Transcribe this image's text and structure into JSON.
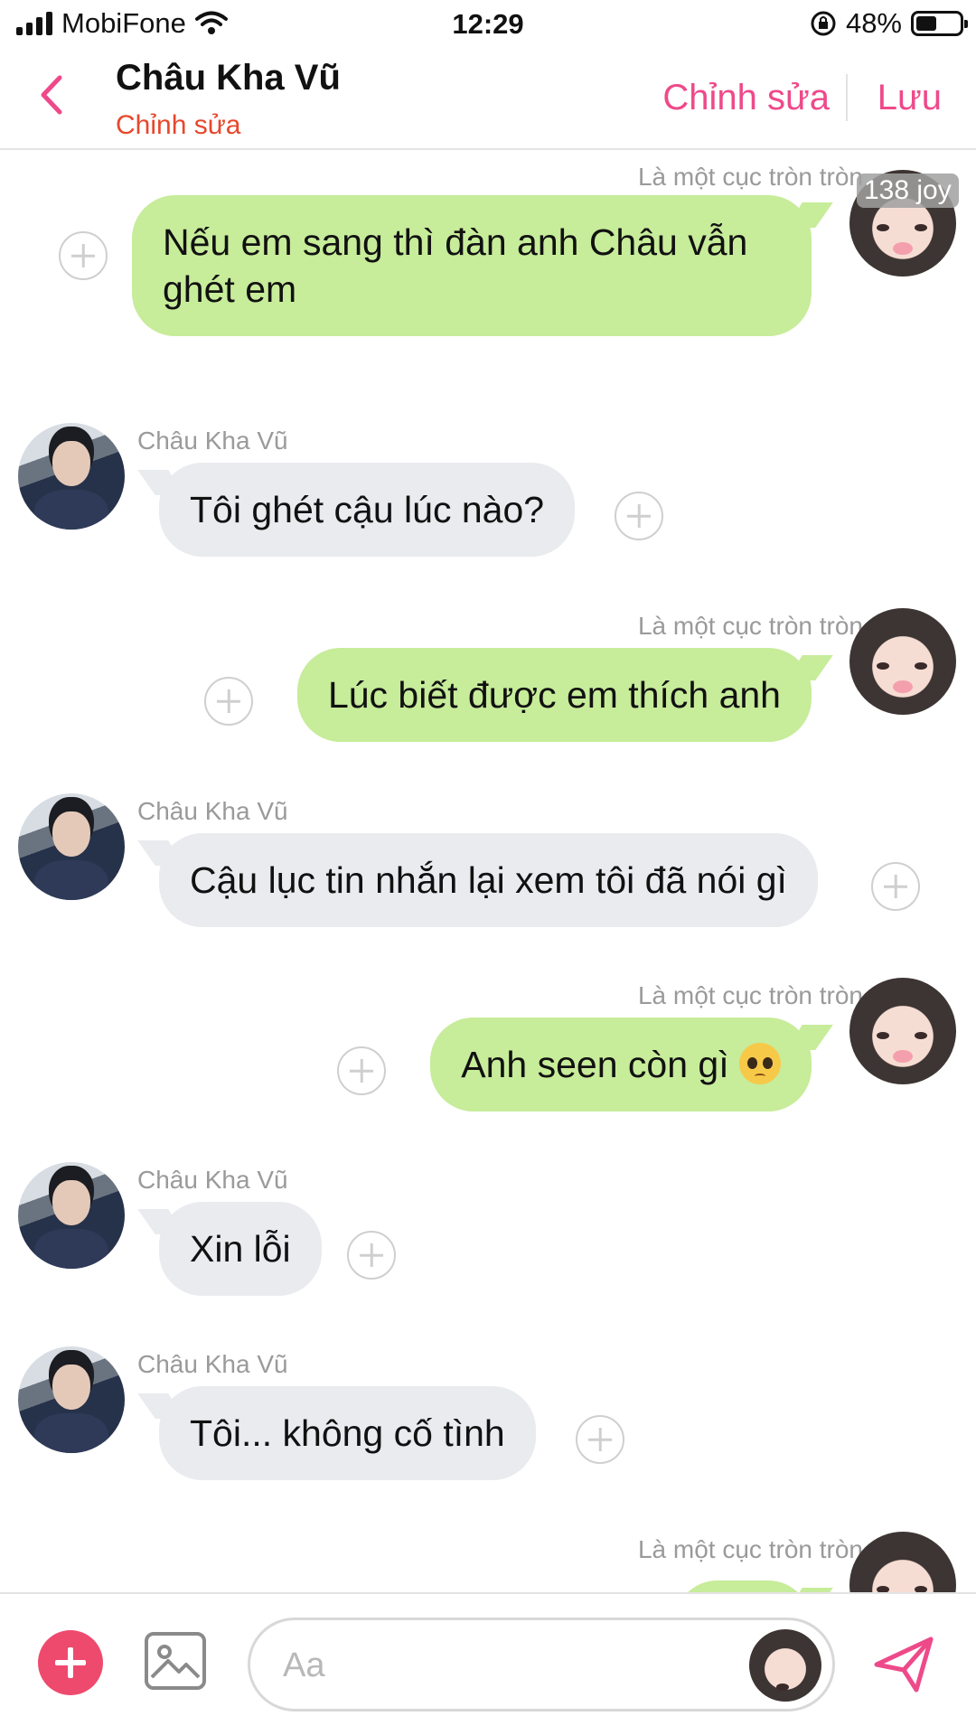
{
  "status_bar": {
    "carrier": "MobiFone",
    "time": "12:29",
    "battery_percent": "48%",
    "battery_level": 0.48,
    "icons": [
      "signal-icon",
      "wifi-icon",
      "rotation-lock-icon",
      "battery-icon"
    ]
  },
  "header": {
    "back_icon": "chevron-left-icon",
    "title": "Châu Kha Vũ",
    "subtitle": "Chỉnh sửa",
    "edit_label": "Chỉnh sửa",
    "save_label": "Lưu",
    "accent_color": "#ee4a8a"
  },
  "badge": "138 joy",
  "messages": [
    {
      "side": "me",
      "sender": "Là một cục tròn tròn",
      "text": "Nếu em sang thì đàn anh Châu vẫn ghét em"
    },
    {
      "side": "other",
      "sender": "Châu Kha Vũ",
      "text": "Tôi ghét cậu lúc nào?"
    },
    {
      "side": "me",
      "sender": "Là một cục tròn tròn",
      "text": "Lúc biết được em thích anh"
    },
    {
      "side": "other",
      "sender": "Châu Kha Vũ",
      "text": "Cậu lục tin nhắn lại xem tôi đã nói gì"
    },
    {
      "side": "me",
      "sender": "Là một cục tròn tròn",
      "text": "Anh seen còn gì",
      "emoji": "pleading-face-emoji"
    },
    {
      "side": "other",
      "sender": "Châu Kha Vũ",
      "text": "Xin lỗi"
    },
    {
      "side": "other",
      "sender": "Châu Kha Vũ",
      "text": "Tôi... không cố tình"
    },
    {
      "side": "me",
      "sender": "Là một cục tròn tròn",
      "text": ""
    }
  ],
  "composer": {
    "placeholder": "Aa",
    "value": "",
    "add_icon": "plus-circle-icon",
    "image_icon": "image-icon",
    "send_icon": "send-icon"
  },
  "colors": {
    "my_bubble": "#c7ec9a",
    "other_bubble": "#e9ebee",
    "subtitle": "#e8472c",
    "add_button": "#ee4a6e"
  }
}
